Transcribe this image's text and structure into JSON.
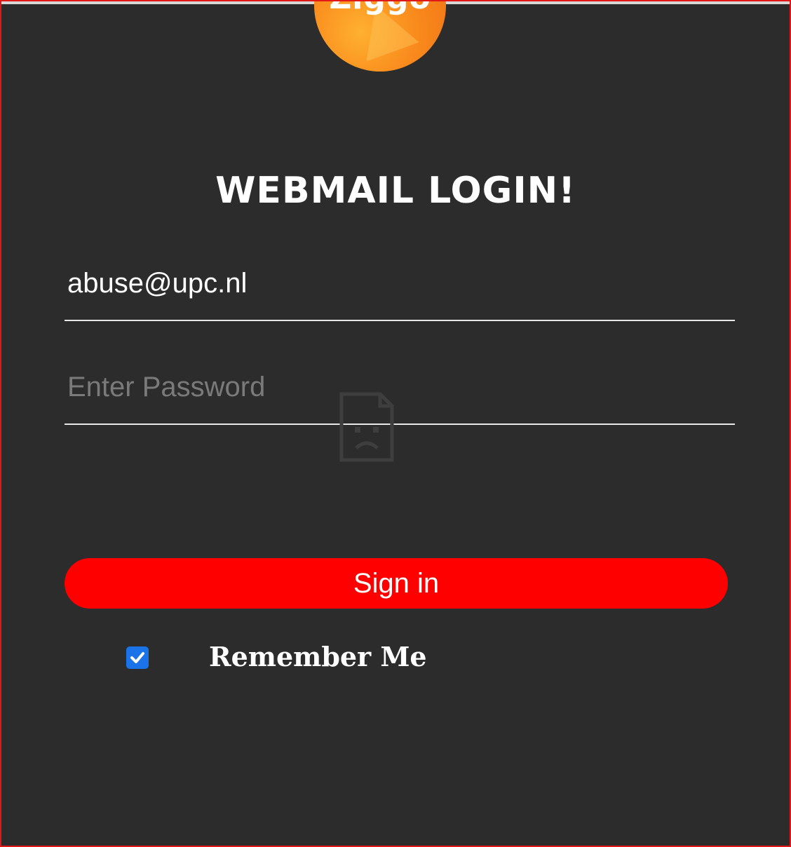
{
  "brand": {
    "logo_text": "Ziggo",
    "logo_color": "#f98a1c"
  },
  "login": {
    "title": "WEBMAIL LOGIN!",
    "email_value": "abuse@upc.nl",
    "password_placeholder": "Enter Password",
    "signin_label": "Sign in",
    "remember_label": "Remember Me",
    "remember_checked": true
  },
  "colors": {
    "background": "#2c2c2c",
    "button": "#ff0000",
    "checkbox": "#1a73e8",
    "border": "#e01818"
  },
  "icons": {
    "broken_image": "broken-image-icon",
    "checkmark": "checkmark-icon"
  }
}
